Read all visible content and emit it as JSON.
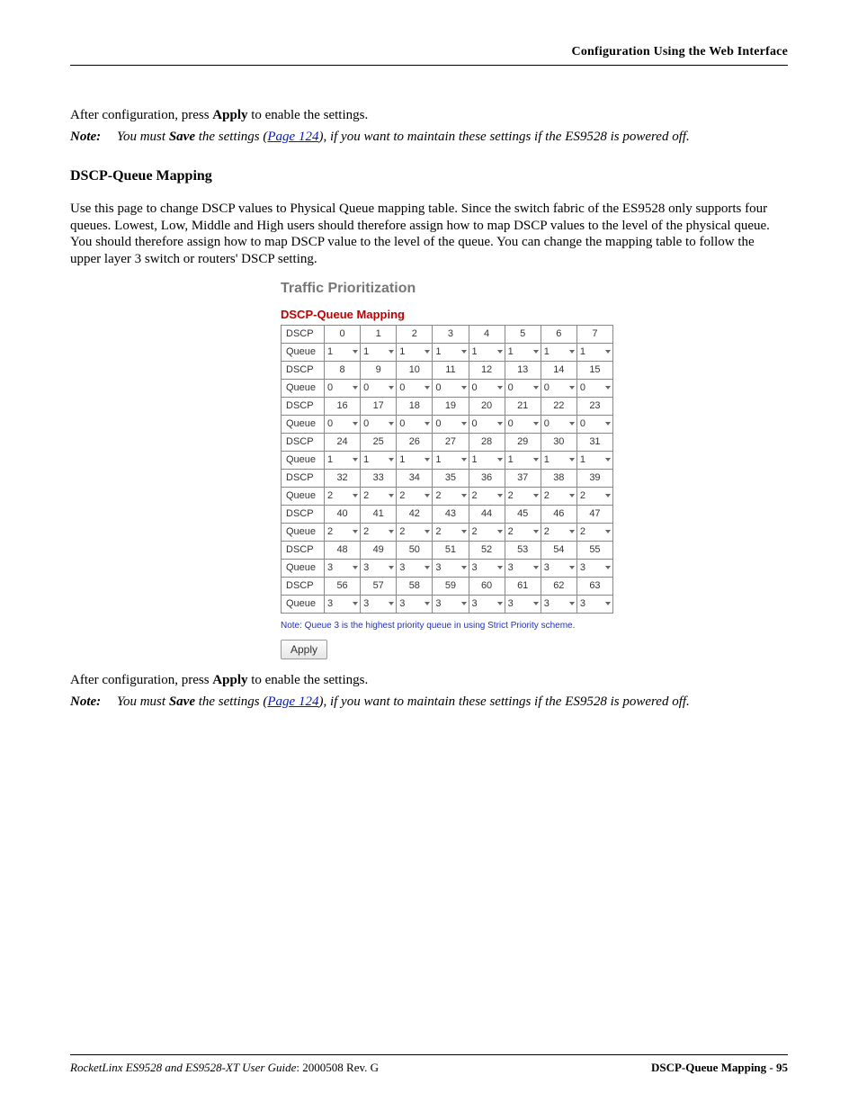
{
  "header": {
    "right": "Configuration Using the Web Interface"
  },
  "intro": {
    "line1_a": "After configuration, press ",
    "line1_b": "Apply",
    "line1_c": " to enable the settings.",
    "note_label": "Note:",
    "note_a": "You must ",
    "note_b": "Save",
    "note_c": " the settings (",
    "note_link": "Page 124",
    "note_d": "), if you want to maintain these settings if the ES9528 is powered off."
  },
  "section": {
    "title": "DSCP-Queue Mapping",
    "para": "Use this page to change DSCP values to Physical Queue mapping table. Since the switch fabric of the ES9528 only supports four queues. Lowest, Low, Middle and High users should therefore assign how to map DSCP values to the level of the physical queue. You should therefore assign how to map DSCP value to the level of the queue. You can change the mapping table to follow the upper layer 3 switch or routers' DSCP setting."
  },
  "ui": {
    "title": "Traffic Prioritization",
    "subtitle": "DSCP-Queue Mapping",
    "row_label_dscp": "DSCP",
    "row_label_queue": "Queue",
    "dscp_rows": [
      [
        "0",
        "1",
        "2",
        "3",
        "4",
        "5",
        "6",
        "7"
      ],
      [
        "8",
        "9",
        "10",
        "11",
        "12",
        "13",
        "14",
        "15"
      ],
      [
        "16",
        "17",
        "18",
        "19",
        "20",
        "21",
        "22",
        "23"
      ],
      [
        "24",
        "25",
        "26",
        "27",
        "28",
        "29",
        "30",
        "31"
      ],
      [
        "32",
        "33",
        "34",
        "35",
        "36",
        "37",
        "38",
        "39"
      ],
      [
        "40",
        "41",
        "42",
        "43",
        "44",
        "45",
        "46",
        "47"
      ],
      [
        "48",
        "49",
        "50",
        "51",
        "52",
        "53",
        "54",
        "55"
      ],
      [
        "56",
        "57",
        "58",
        "59",
        "60",
        "61",
        "62",
        "63"
      ]
    ],
    "queue_rows": [
      [
        "1",
        "1",
        "1",
        "1",
        "1",
        "1",
        "1",
        "1"
      ],
      [
        "0",
        "0",
        "0",
        "0",
        "0",
        "0",
        "0",
        "0"
      ],
      [
        "0",
        "0",
        "0",
        "0",
        "0",
        "0",
        "0",
        "0"
      ],
      [
        "1",
        "1",
        "1",
        "1",
        "1",
        "1",
        "1",
        "1"
      ],
      [
        "2",
        "2",
        "2",
        "2",
        "2",
        "2",
        "2",
        "2"
      ],
      [
        "2",
        "2",
        "2",
        "2",
        "2",
        "2",
        "2",
        "2"
      ],
      [
        "3",
        "3",
        "3",
        "3",
        "3",
        "3",
        "3",
        "3"
      ],
      [
        "3",
        "3",
        "3",
        "3",
        "3",
        "3",
        "3",
        "3"
      ]
    ],
    "note": "Note: Queue 3 is the highest priority queue in using Strict Priority scheme.",
    "apply": "Apply"
  },
  "outro": {
    "line1_a": "After configuration, press ",
    "line1_b": "Apply",
    "line1_c": " to enable the settings.",
    "note_label": "Note:",
    "note_a": "You must ",
    "note_b": "Save",
    "note_c": " the settings (",
    "note_link": "Page 124",
    "note_d": "), if you want to maintain these settings if the ES9528 is powered off."
  },
  "footer": {
    "left_i": "RocketLinx ES9528 and ES9528-XT User Guide",
    "left_r": ": 2000508 Rev. G",
    "right": "DSCP-Queue Mapping - 95"
  }
}
